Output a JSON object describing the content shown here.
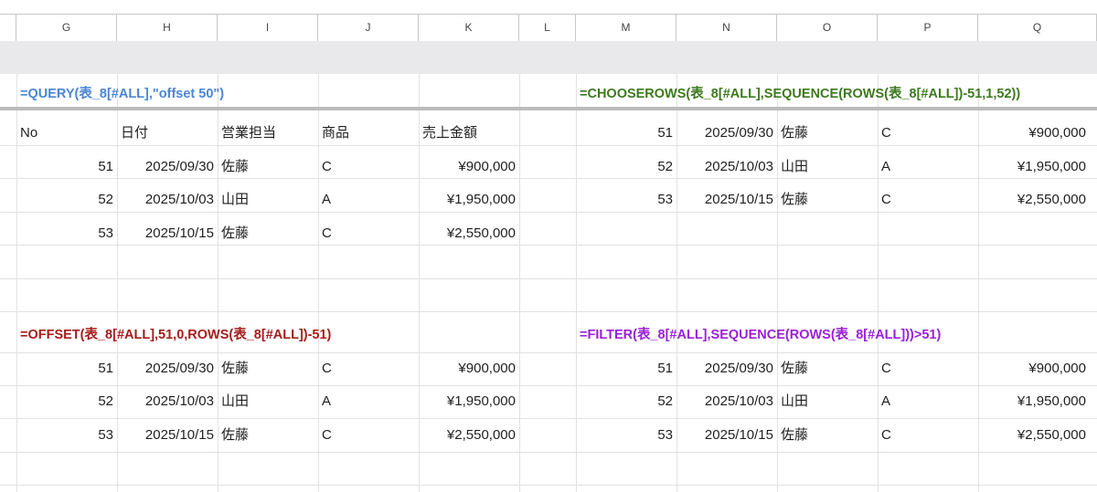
{
  "columns": [
    "G",
    "H",
    "I",
    "J",
    "K",
    "L",
    "M",
    "N",
    "O",
    "P",
    "Q"
  ],
  "colors": {
    "query": "#4a86d8",
    "chooserows": "#3d7a1f",
    "offset": "#a61c1c",
    "filter": "#9b20d9"
  },
  "formulas": {
    "query": "=QUERY(表_8[#ALL],\"offset 50\")",
    "chooserows": "=CHOOSEROWS(表_8[#ALL],SEQUENCE(ROWS(表_8[#ALL])-51,1,52))",
    "offset": "=OFFSET(表_8[#ALL],51,0,ROWS(表_8[#ALL])-51)",
    "filter": "=FILTER(表_8[#ALL],SEQUENCE(ROWS(表_8[#ALL]))>51)"
  },
  "headers": [
    "No",
    "日付",
    "営業担当",
    "商品",
    "売上金額"
  ],
  "rows": [
    [
      "51",
      "2025/09/30",
      "佐藤",
      "C",
      "¥900,000"
    ],
    [
      "52",
      "2025/10/03",
      "山田",
      "A",
      "¥1,950,000"
    ],
    [
      "53",
      "2025/10/15",
      "佐藤",
      "C",
      "¥2,550,000"
    ]
  ]
}
